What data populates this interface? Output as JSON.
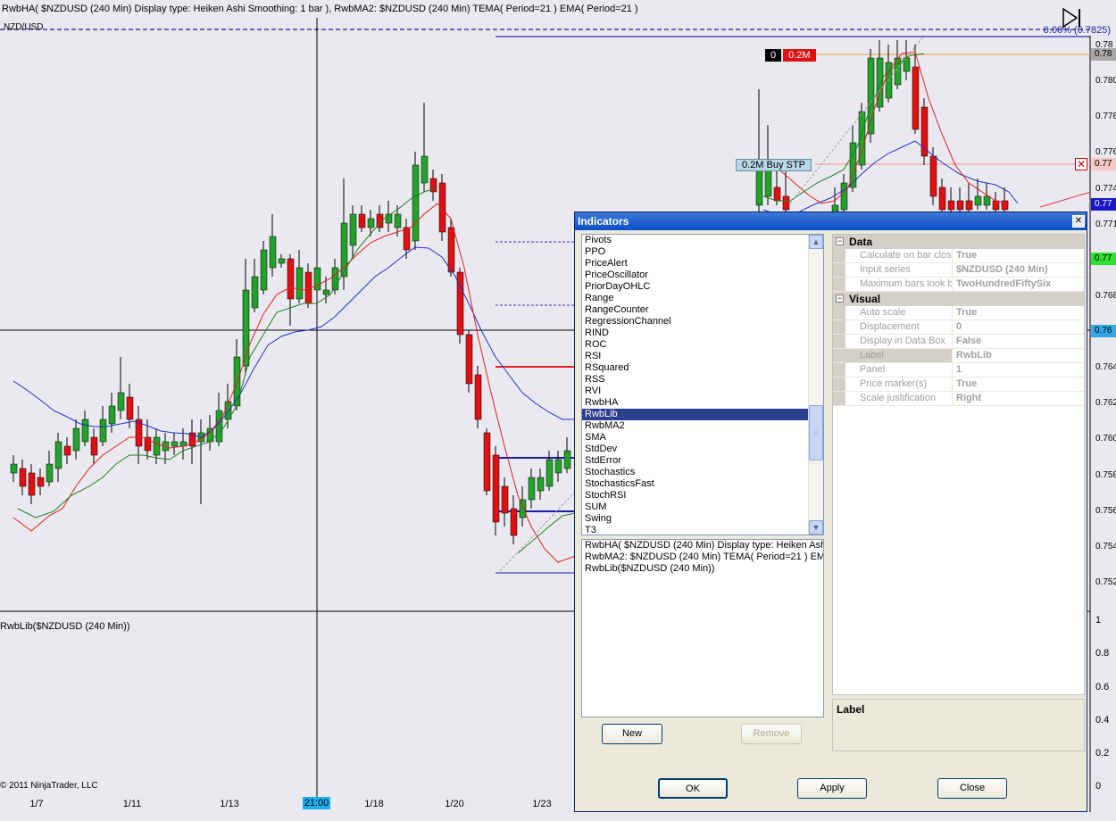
{
  "chart": {
    "header": "RwbHA( $NZDUSD (240 Min)   Display type: Heiken Ashi   Smoothing: 1 bar ), RwbMA2: $NZDUSD (240 Min)   TEMA( Period=21 )   EMA( Period=21 )",
    "instrument": "NZD/USD",
    "percent_label": "0.00% (0.7825)",
    "lower_panel_label": "RwbLib($NZDUSD (240 Min))",
    "copyright": "© 2011 NinjaTrader, LLC",
    "cursor_time": "21:00",
    "x_labels": [
      "1/7",
      "1/11",
      "1/13",
      "1/18",
      "1/20",
      "1/23"
    ],
    "order_qty_a": "0",
    "order_qty_b": "0.2M",
    "buy_stop": "0.2M   Buy STP",
    "price_ticks": [
      "0.78",
      "0.78",
      "0.780",
      "0.778",
      "0.776",
      "0.774",
      "0.771",
      "0.768",
      "0.766",
      "0.764",
      "0.762",
      "0.760",
      "0.758",
      "0.756",
      "0.754",
      "0.752"
    ],
    "price_markers": {
      "top": "0.78",
      "red": "0.77",
      "blue": "0.77",
      "green": "0.77",
      "cyan": "0.76"
    },
    "lower_ticks": [
      "1",
      "0.8",
      "0.6",
      "0.4",
      "0.2",
      "0"
    ]
  },
  "dialog": {
    "title": "Indicators",
    "indicator_list": [
      "Pivots",
      "PPO",
      "PriceAlert",
      "PriceOscillator",
      "PriorDayOHLC",
      "Range",
      "RangeCounter",
      "RegressionChannel",
      "RIND",
      "ROC",
      "RSI",
      "RSquared",
      "RSS",
      "RVI",
      "RwbHA",
      "RwbLib",
      "RwbMA2",
      "SMA",
      "StdDev",
      "StdError",
      "Stochastics",
      "StochasticsFast",
      "StochRSI",
      "SUM",
      "Swing",
      "T3"
    ],
    "selected_indicator": "RwbLib",
    "applied": [
      "RwbHA( $NZDUSD (240 Min)   Display type: Heiken Ashi",
      "RwbMA2: $NZDUSD (240 Min)   TEMA( Period=21 )   EMA",
      "RwbLib($NZDUSD (240 Min))"
    ],
    "buttons": {
      "new": "New",
      "remove": "Remove",
      "ok": "OK",
      "apply": "Apply",
      "close": "Close"
    },
    "properties": {
      "data_category": "Data",
      "visual_category": "Visual",
      "data_rows": [
        {
          "name": "Calculate on bar close",
          "value": "True"
        },
        {
          "name": "Input series",
          "value": "$NZDUSD (240 Min)"
        },
        {
          "name": "Maximum bars look back",
          "value": "TwoHundredFiftySix"
        }
      ],
      "visual_rows": [
        {
          "name": "Auto scale",
          "value": "True"
        },
        {
          "name": "Displacement",
          "value": "0"
        },
        {
          "name": "Display in Data Box",
          "value": "False"
        },
        {
          "name": "Label",
          "value": "RwbLib"
        },
        {
          "name": "Panel",
          "value": "1"
        },
        {
          "name": "Price marker(s)",
          "value": "True"
        },
        {
          "name": "Scale justification",
          "value": "Right"
        }
      ]
    },
    "description_title": "Label"
  },
  "colors": {
    "up_candle": "#22a22a",
    "down_candle": "#e01010",
    "tema_line": "#e02020",
    "ema_line": "#2030d0",
    "band_line": "#208020",
    "selection": "#2b3f91"
  }
}
